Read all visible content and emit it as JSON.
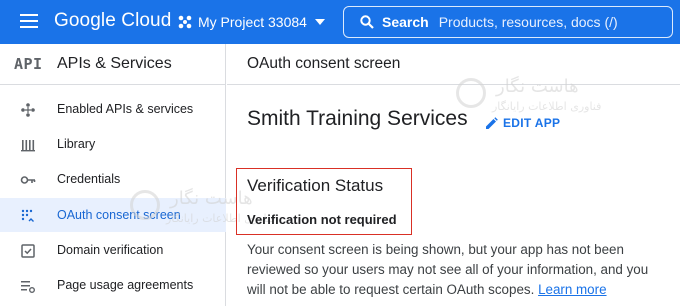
{
  "header": {
    "brand": "Google Cloud",
    "project": "My Project 33084",
    "search_label": "Search",
    "search_placeholder": "Products, resources, docs (/)"
  },
  "sidebar": {
    "logo": "API",
    "title": "APIs & Services",
    "items": [
      {
        "label": "Enabled APIs & services",
        "icon": "diamond-icon"
      },
      {
        "label": "Library",
        "icon": "library-icon"
      },
      {
        "label": "Credentials",
        "icon": "key-icon"
      },
      {
        "label": "OAuth consent screen",
        "icon": "consent-grid-icon",
        "active": true
      },
      {
        "label": "Domain verification",
        "icon": "checkbox-icon"
      },
      {
        "label": "Page usage agreements",
        "icon": "settings-list-icon"
      }
    ]
  },
  "main": {
    "page_title": "OAuth consent screen",
    "app_name": "Smith Training Services",
    "edit_label": "EDIT APP",
    "verification_title": "Verification Status",
    "verification_status": "Verification not required",
    "description": "Your consent screen is being shown, but your app has not been reviewed so your users may not see all of your information, and you will not be able to request certain OAuth scopes.",
    "learn_more": "Learn more"
  },
  "watermark": {
    "line1": "هاست نگار",
    "line2": "فناوری اطلاعات رایانگار"
  },
  "colors": {
    "brand_blue": "#1a73e8",
    "active_bg": "#e8f0fe",
    "highlight_red": "#d93025"
  }
}
